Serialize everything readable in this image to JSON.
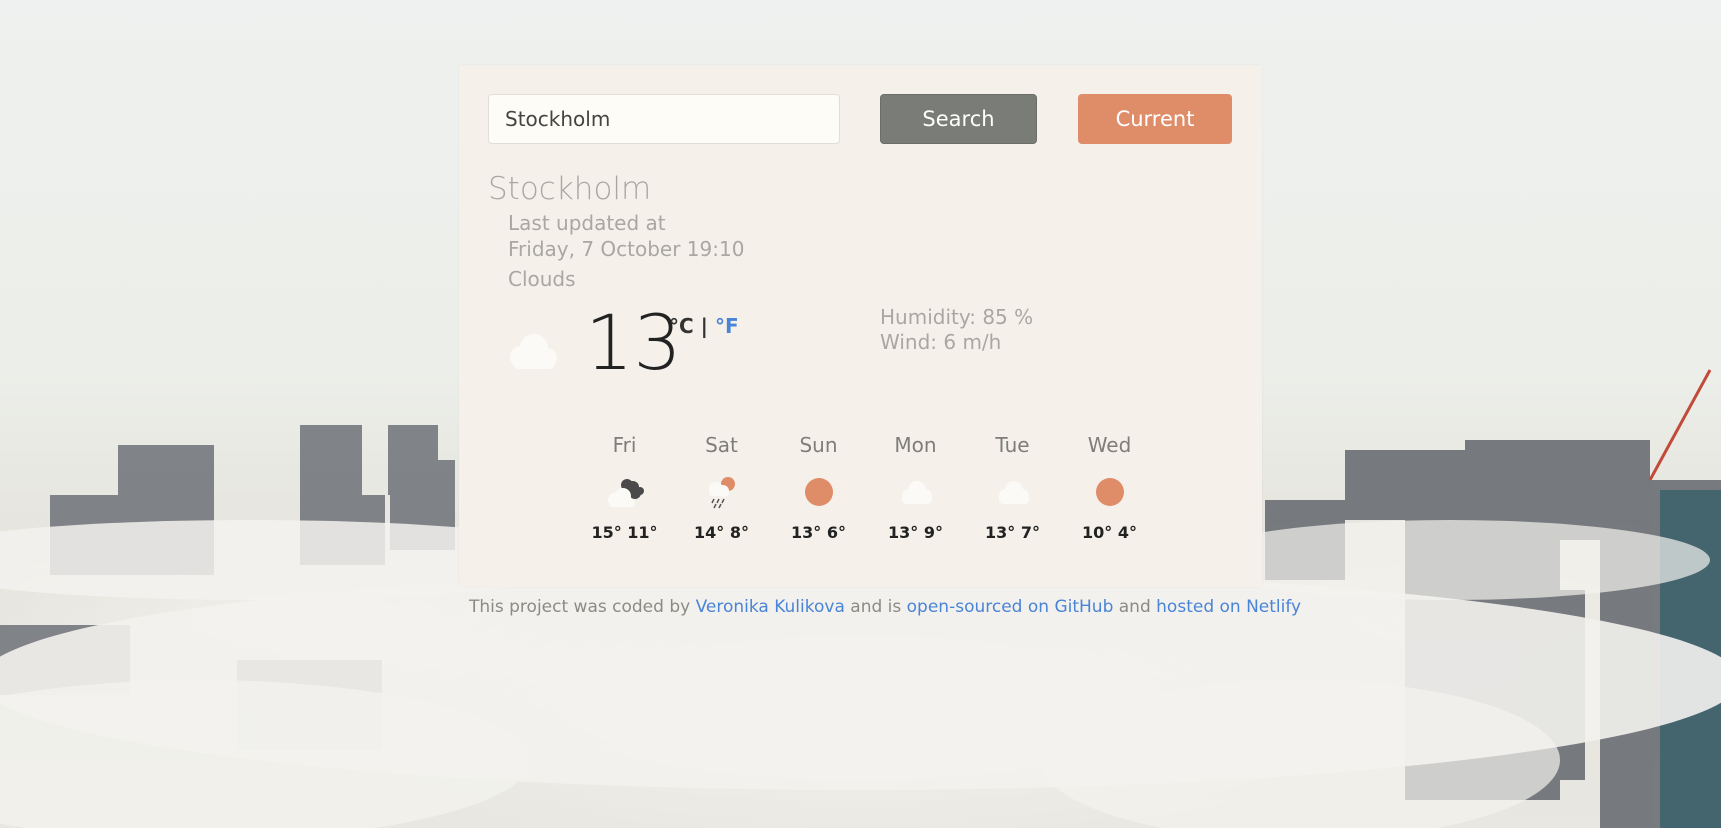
{
  "colors": {
    "accent": "#df8c68",
    "search_button": "#7a7c77",
    "link": "#4a84d6",
    "card": "#f5f1ea"
  },
  "search": {
    "value": "Stockholm",
    "button_label": "Search",
    "current_label": "Current"
  },
  "weather": {
    "city": "Stockholm",
    "updated_label": "Last updated at",
    "updated_time": "Friday, 7 October 19:10",
    "description": "Clouds",
    "icon": "cloud-icon",
    "temperature": "13",
    "unit_c": "°C",
    "unit_sep": "|",
    "unit_f": "°F",
    "humidity": "Humidity: 85 %",
    "wind": "Wind: 6 m/h"
  },
  "forecast": [
    {
      "day": "Fri",
      "temps": "15° 11°",
      "icon": "broken-clouds-icon"
    },
    {
      "day": "Sat",
      "temps": "14° 8°",
      "icon": "rain-sun-icon"
    },
    {
      "day": "Sun",
      "temps": "13° 6°",
      "icon": "sun-icon"
    },
    {
      "day": "Mon",
      "temps": "13° 9°",
      "icon": "cloud-icon"
    },
    {
      "day": "Tue",
      "temps": "13° 7°",
      "icon": "cloud-icon"
    },
    {
      "day": "Wed",
      "temps": "10° 4°",
      "icon": "sun-icon"
    }
  ],
  "footer": {
    "text1": "This project was coded by ",
    "author": "Veronika Kulikova",
    "text2": " and is ",
    "repo": "open-sourced on GitHub",
    "text3": " and ",
    "host": "hosted on Netlify"
  }
}
